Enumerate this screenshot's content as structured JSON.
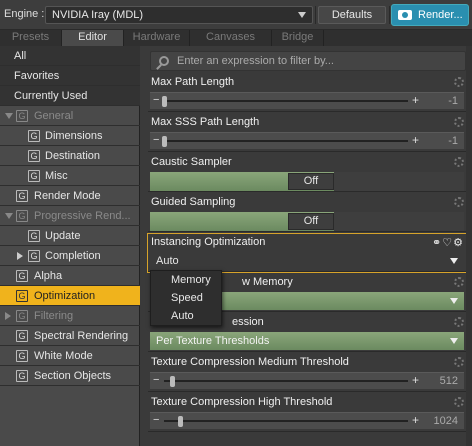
{
  "engine": {
    "label": "Engine :",
    "value": "NVIDIA Iray (MDL)",
    "defaults": "Defaults",
    "render": "Render..."
  },
  "tabs": [
    "Presets",
    "Editor",
    "Hardware",
    "Canvases",
    "Bridge"
  ],
  "sidebar": {
    "items": [
      {
        "label": "All"
      },
      {
        "label": "Favorites"
      },
      {
        "label": "Currently Used"
      },
      {
        "label": "General"
      },
      {
        "label": "Dimensions"
      },
      {
        "label": "Destination"
      },
      {
        "label": "Misc"
      },
      {
        "label": "Render Mode"
      },
      {
        "label": "Progressive Rend..."
      },
      {
        "label": "Update"
      },
      {
        "label": "Completion"
      },
      {
        "label": "Alpha"
      },
      {
        "label": "Optimization"
      },
      {
        "label": "Filtering"
      },
      {
        "label": "Spectral Rendering"
      },
      {
        "label": "White Mode"
      },
      {
        "label": "Section Objects"
      }
    ],
    "icon_letter": "G"
  },
  "filter": {
    "placeholder": "Enter an expression to filter by..."
  },
  "props": {
    "max_path": {
      "title": "Max Path Length",
      "value": "-1"
    },
    "max_sss": {
      "title": "Max SSS Path Length",
      "value": "-1"
    },
    "caustic": {
      "title": "Caustic Sampler",
      "value": "Off"
    },
    "guided": {
      "title": "Guided Sampling",
      "value": "Off"
    },
    "instancing": {
      "title": "Instancing Optimization",
      "value": "Auto"
    },
    "low_memory": {
      "title": "w Memory"
    },
    "compression": {
      "title": "ession",
      "value": "Per Texture Thresholds"
    },
    "tex_medium": {
      "title": "Texture Compression Medium Threshold",
      "value": "512"
    },
    "tex_high": {
      "title": "Texture Compression High Threshold",
      "value": "1024"
    }
  },
  "dropdown": {
    "options": [
      "Memory",
      "Speed",
      "Auto"
    ]
  }
}
